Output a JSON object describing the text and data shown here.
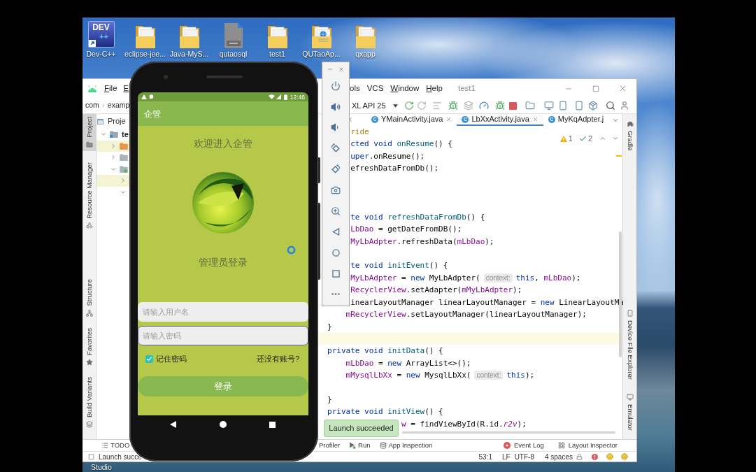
{
  "desktop": {
    "icons": [
      {
        "label": "Dev-C++",
        "kind": "dev_cpp",
        "logo_text": [
          "DEV",
          "++"
        ]
      },
      {
        "label": "eclipse-jee...",
        "kind": "folder"
      },
      {
        "label": "Java-MyS...",
        "kind": "folder"
      },
      {
        "label": "qutaosql",
        "kind": "document"
      },
      {
        "label": "test1",
        "kind": "folder"
      },
      {
        "label": "QUTaoAp...",
        "kind": "web_folder"
      },
      {
        "label": "qxapp",
        "kind": "folder"
      }
    ],
    "cut_icon_label": "Studio"
  },
  "ide": {
    "menu_left": [
      {
        "label": "File",
        "mnemonic": true
      },
      {
        "label": "E",
        "mnemonic": true
      }
    ],
    "menu_right": [
      {
        "label": "ols",
        "mnemonic": false
      },
      {
        "label": "VCS",
        "mnemonic": false
      },
      {
        "label": "Window",
        "mnemonic": true
      },
      {
        "label": "Help",
        "mnemonic": true
      }
    ],
    "project_name": "test1",
    "breadcrumb": [
      "com",
      "examp"
    ],
    "device_selector": "XL API 25",
    "left_tools_top": [
      {
        "label": "Project",
        "kind": "project",
        "selected": true
      },
      {
        "label": "Resource Manager",
        "kind": "resource_manager",
        "selected": false
      }
    ],
    "left_tools_bottom": [
      {
        "label": "Structure",
        "kind": "structure",
        "selected": false
      },
      {
        "label": "Favorites",
        "kind": "favorites",
        "selected": false
      },
      {
        "label": "Build Variants",
        "kind": "build_variants",
        "selected": false
      }
    ],
    "right_tools_top": [
      {
        "label": "Gradle",
        "kind": "gradle"
      }
    ],
    "right_tools_bottom": [
      {
        "label": "Device File Explorer",
        "kind": "device_file_explorer"
      },
      {
        "label": "Emulator",
        "kind": "emulator"
      }
    ],
    "project_panel": {
      "title": "Proje",
      "tree": [
        {
          "label": "te",
          "kind": "module",
          "expanded": true,
          "highlighted": false,
          "children": [
            {
              "kind": "orange_folder",
              "expanded": false,
              "highlighted": true
            },
            {
              "kind": "folder",
              "expanded": false,
              "highlighted": false
            },
            {
              "kind": "android_module",
              "expanded": true,
              "highlighted": false,
              "children": [
                {
                  "expanded": false,
                  "highlighted": true
                },
                {
                  "expanded": true,
                  "highlighted": false
                }
              ]
            }
          ]
        }
      ]
    },
    "editor_tabs": [
      {
        "kind": "cut_start",
        "selected": false
      },
      {
        "kind": "full",
        "type_badge": "C",
        "label": "YMainActivity.java",
        "selected": false
      },
      {
        "kind": "full",
        "type_badge": "C",
        "label": "LbXxActivity.java",
        "selected": true
      },
      {
        "kind": "cut_end",
        "type_badge": "C",
        "label": "MyKqAdpter.j",
        "selected": false
      }
    ],
    "inspections": {
      "warnings": "1",
      "weak_warnings": "2"
    },
    "code_lines": [
      {
        "kind": "cut_by_toolbar",
        "current": false,
        "tokens": [
          {
            "kind": "annotation",
            "text": "ride"
          }
        ]
      },
      {
        "kind": "cut_by_toolbar",
        "current": false,
        "tokens": [
          {
            "kind": "keyword",
            "text": "cted void"
          },
          {
            "kind": "method",
            "text": " onResume"
          },
          {
            "kind": "plain",
            "text": "() {"
          }
        ]
      },
      {
        "kind": "cut_by_toolbar",
        "current": false,
        "tokens": [
          {
            "kind": "keyword",
            "text": "uper"
          },
          {
            "kind": "plain",
            "text": ".onResume();"
          }
        ]
      },
      {
        "kind": "cut_by_toolbar",
        "current": false,
        "tokens": [
          {
            "kind": "plain",
            "text": "efreshDataFromDb();"
          }
        ]
      },
      {
        "kind": "blank",
        "current": false
      },
      {
        "kind": "blank",
        "current": false
      },
      {
        "kind": "blank",
        "current": false
      },
      {
        "kind": "cut_by_toolbar",
        "current": false,
        "tokens": [
          {
            "kind": "keyword",
            "text": "te void"
          },
          {
            "kind": "method",
            "text": " refreshDataFromDb"
          },
          {
            "kind": "plain",
            "text": "() {"
          }
        ]
      },
      {
        "kind": "cut_by_toolbar",
        "current": false,
        "tokens": [
          {
            "kind": "field",
            "text": "LbDao"
          },
          {
            "kind": "plain",
            "text": " = getDateFromDB();"
          }
        ]
      },
      {
        "kind": "cut_by_toolbar",
        "current": false,
        "tokens": [
          {
            "kind": "field",
            "text": "MyLbAdpter"
          },
          {
            "kind": "plain",
            "text": ".refreshData("
          },
          {
            "kind": "field",
            "text": "mLbDao"
          },
          {
            "kind": "plain",
            "text": ");"
          }
        ]
      },
      {
        "kind": "blank",
        "current": false
      },
      {
        "kind": "cut_by_toolbar",
        "current": false,
        "tokens": [
          {
            "kind": "keyword",
            "text": "te void"
          },
          {
            "kind": "method",
            "text": " initEvent"
          },
          {
            "kind": "plain",
            "text": "() {"
          }
        ]
      },
      {
        "kind": "cut_by_toolbar",
        "current": false,
        "tokens": [
          {
            "kind": "field",
            "text": "MyLbAdpter"
          },
          {
            "kind": "plain",
            "text": " = "
          },
          {
            "kind": "keyword",
            "text": "new"
          },
          {
            "kind": "plain",
            "text": " MyLbAdpter("
          },
          {
            "kind": "hint",
            "text": "context:"
          },
          {
            "kind": "keyword",
            "text": "this"
          },
          {
            "kind": "plain",
            "text": ", "
          },
          {
            "kind": "field",
            "text": "mLbDao"
          },
          {
            "kind": "plain",
            "text": ");"
          }
        ]
      },
      {
        "kind": "cut_by_toolbar",
        "current": false,
        "tokens": [
          {
            "kind": "field",
            "text": "RecyclerView"
          },
          {
            "kind": "plain",
            "text": ".setAdapter("
          },
          {
            "kind": "field",
            "text": "mMyLbAdpter"
          },
          {
            "kind": "plain",
            "text": ");"
          }
        ]
      },
      {
        "kind": "cut_by_toolbar",
        "current": false,
        "tokens": [
          {
            "kind": "plain",
            "text": "inearLayoutManager linearLayoutManager = "
          },
          {
            "kind": "keyword",
            "text": "new"
          },
          {
            "kind": "plain",
            "text": " LinearLayoutMa"
          }
        ]
      },
      {
        "kind": "statement",
        "current": false,
        "tokens": [
          {
            "kind": "field",
            "text": "mRecyclerView"
          },
          {
            "kind": "plain",
            "text": ".setLayoutManager(linearLayoutManager);"
          }
        ]
      },
      {
        "kind": "member",
        "current": false,
        "tokens": [
          {
            "kind": "plain",
            "text": "}"
          }
        ]
      },
      {
        "kind": "blank",
        "current": true
      },
      {
        "kind": "member",
        "current": false,
        "tokens": [
          {
            "kind": "keyword",
            "text": "private void"
          },
          {
            "kind": "method",
            "text": " initData"
          },
          {
            "kind": "plain",
            "text": "() {"
          }
        ]
      },
      {
        "kind": "statement",
        "current": false,
        "tokens": [
          {
            "kind": "field",
            "text": "mLbDao"
          },
          {
            "kind": "plain",
            "text": " = "
          },
          {
            "kind": "keyword",
            "text": "new"
          },
          {
            "kind": "plain",
            "text": " ArrayList<>();"
          }
        ]
      },
      {
        "kind": "statement",
        "current": false,
        "tokens": [
          {
            "kind": "field",
            "text": "mMysqlLbXx"
          },
          {
            "kind": "plain",
            "text": " = "
          },
          {
            "kind": "keyword",
            "text": "new"
          },
          {
            "kind": "plain",
            "text": " MysqlLbXx("
          },
          {
            "kind": "hint",
            "text": "context:"
          },
          {
            "kind": "keyword",
            "text": "this"
          },
          {
            "kind": "plain",
            "text": ");"
          }
        ]
      },
      {
        "kind": "blank",
        "current": false
      },
      {
        "kind": "member",
        "current": false,
        "tokens": [
          {
            "kind": "plain",
            "text": "}"
          }
        ]
      },
      {
        "kind": "member",
        "current": false,
        "tokens": [
          {
            "kind": "keyword",
            "text": "private void"
          },
          {
            "kind": "method",
            "text": " initView"
          },
          {
            "kind": "plain",
            "text": "() {"
          }
        ]
      },
      {
        "kind": "cut_by_toast",
        "current": false,
        "tokens": [
          {
            "kind": "field",
            "text": "w"
          },
          {
            "kind": "plain",
            "text": " = findViewById(R.id."
          },
          {
            "kind": "field_italic",
            "text": "r2v"
          },
          {
            "kind": "plain",
            "text": ");"
          }
        ]
      }
    ],
    "tool_windows_left": [
      {
        "label": "TODO",
        "kind": "todo"
      }
    ],
    "tool_windows_middle": [
      {
        "label": "Profiler",
        "kind": "profiler"
      },
      {
        "label": "Run",
        "kind": "run"
      },
      {
        "label": "App Inspection",
        "kind": "app_inspection"
      }
    ],
    "tool_windows_right": [
      {
        "label": "Event Log",
        "kind": "event_log"
      },
      {
        "label": "Layout Inspector",
        "kind": "layout_inspector"
      }
    ],
    "status_bar": {
      "message": "Launch succe",
      "widgets": [
        "53:1",
        "LF",
        "UTF-8",
        "4 spaces"
      ]
    }
  },
  "phone": {
    "status_time": "12:46",
    "app_title": "企管",
    "welcome": "欢迎进入企管",
    "heading": "管理员登录",
    "fields": [
      {
        "placeholder": "请输入用户名",
        "focused": false
      },
      {
        "placeholder": "请输入密码",
        "focused": true
      }
    ],
    "remember": {
      "label": "记住密码",
      "checked": true
    },
    "register_link": "还没有账号?",
    "login_button": "登录"
  },
  "toast": {
    "text": "Launch succeeded"
  }
}
